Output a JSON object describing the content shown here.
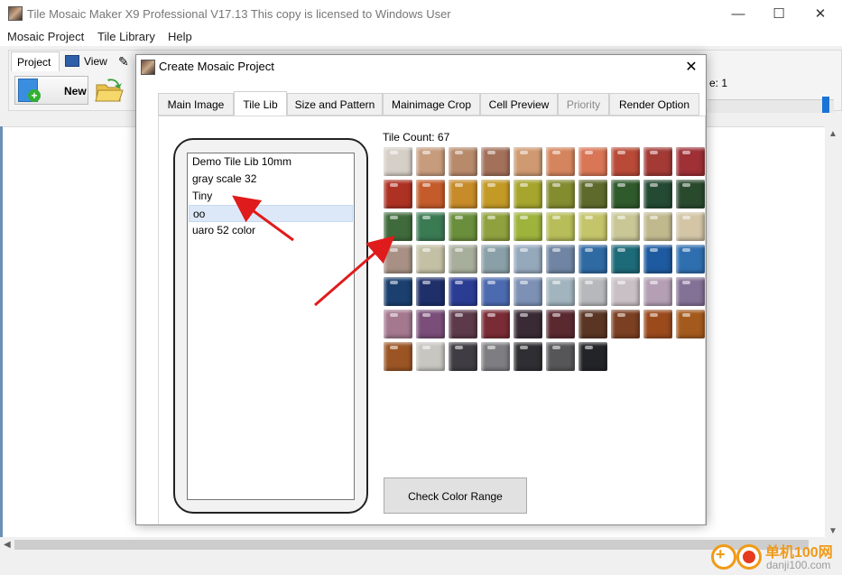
{
  "window": {
    "title": "Tile Mosaic Maker X9 Professional V17.13   This copy is licensed to Windows User",
    "minimize_glyph": "—",
    "maximize_glyph": "☐",
    "close_glyph": "✕"
  },
  "menu": [
    "Mosaic Project",
    "Tile Library",
    "Help"
  ],
  "ribbon": {
    "tabs": [
      "Project",
      "View"
    ],
    "new_label": "New",
    "right_label": "e: 1"
  },
  "dialog": {
    "title": "Create Mosaic Project",
    "close_glyph": "✕",
    "tabs": [
      {
        "label": "Main Image",
        "state": "normal"
      },
      {
        "label": "Tile Lib",
        "state": "active"
      },
      {
        "label": "Size and Pattern",
        "state": "normal"
      },
      {
        "label": "Mainimage Crop",
        "state": "normal"
      },
      {
        "label": "Cell Preview",
        "state": "normal"
      },
      {
        "label": "Priority",
        "state": "disabled"
      },
      {
        "label": "Render Option",
        "state": "normal"
      }
    ],
    "library_list": [
      "Demo Tile Lib 10mm",
      "gray scale 32",
      "Tiny",
      "oo",
      "uaro 52 color"
    ],
    "selected_library": "oo",
    "tile_count_label": "Tile Count: 67",
    "check_button": "Check Color Range",
    "tile_colors": [
      "#d6cfc7",
      "#c79c7d",
      "#b88a6c",
      "#a3705a",
      "#cf9a72",
      "#d5855e",
      "#d97656",
      "#b94a38",
      "#a33a35",
      "#9e3036",
      "#ae3224",
      "#c45b2a",
      "#c78b2a",
      "#c49a27",
      "#a6a52d",
      "#848c30",
      "#5e6a2c",
      "#2f5a2c",
      "#244a33",
      "#2a4a2e",
      "#3f6b3c",
      "#3a7b53",
      "#6a8f3c",
      "#8fa13e",
      "#9db33c",
      "#b7bd58",
      "#c4c46b",
      "#c9c796",
      "#c1b98e",
      "#d3c5a6",
      "#a89184",
      "#c4c0a5",
      "#a8ae9c",
      "#8aa0a8",
      "#95a9bd",
      "#6f85a3",
      "#2f6aa3",
      "#1d6a78",
      "#1d5aa0",
      "#2f6fb0",
      "#1b3f6e",
      "#1e2f6a",
      "#2a3d93",
      "#4c6ab0",
      "#7d91b5",
      "#a2b4be",
      "#b7b8bb",
      "#c9c0c5",
      "#b49fb4",
      "#847196",
      "#a4788f",
      "#7a4e78",
      "#5c3a4a",
      "#7a2c36",
      "#3a2a35",
      "#5a2930",
      "#5a3524",
      "#7b3f22",
      "#9b4a1c",
      "#a45a1d",
      "#9b5524",
      "#c8c6c0",
      "#3f3d43",
      "#7e7e82",
      "#2f2f33",
      "#565659",
      "#232428"
    ],
    "tile_columns": 10
  },
  "watermark": {
    "site_cn": "单机100网",
    "site_url": "danji100.com"
  }
}
